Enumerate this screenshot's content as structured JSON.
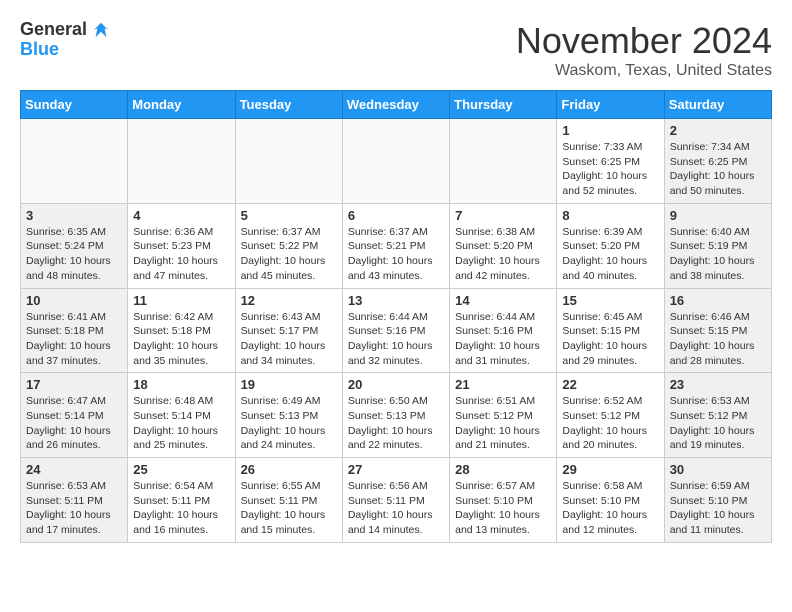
{
  "header": {
    "logo_general": "General",
    "logo_blue": "Blue",
    "month": "November 2024",
    "location": "Waskom, Texas, United States"
  },
  "weekdays": [
    "Sunday",
    "Monday",
    "Tuesday",
    "Wednesday",
    "Thursday",
    "Friday",
    "Saturday"
  ],
  "weeks": [
    [
      {
        "day": "",
        "info": ""
      },
      {
        "day": "",
        "info": ""
      },
      {
        "day": "",
        "info": ""
      },
      {
        "day": "",
        "info": ""
      },
      {
        "day": "",
        "info": ""
      },
      {
        "day": "1",
        "info": "Sunrise: 7:33 AM\nSunset: 6:25 PM\nDaylight: 10 hours\nand 52 minutes."
      },
      {
        "day": "2",
        "info": "Sunrise: 7:34 AM\nSunset: 6:25 PM\nDaylight: 10 hours\nand 50 minutes."
      }
    ],
    [
      {
        "day": "3",
        "info": "Sunrise: 6:35 AM\nSunset: 5:24 PM\nDaylight: 10 hours\nand 48 minutes."
      },
      {
        "day": "4",
        "info": "Sunrise: 6:36 AM\nSunset: 5:23 PM\nDaylight: 10 hours\nand 47 minutes."
      },
      {
        "day": "5",
        "info": "Sunrise: 6:37 AM\nSunset: 5:22 PM\nDaylight: 10 hours\nand 45 minutes."
      },
      {
        "day": "6",
        "info": "Sunrise: 6:37 AM\nSunset: 5:21 PM\nDaylight: 10 hours\nand 43 minutes."
      },
      {
        "day": "7",
        "info": "Sunrise: 6:38 AM\nSunset: 5:20 PM\nDaylight: 10 hours\nand 42 minutes."
      },
      {
        "day": "8",
        "info": "Sunrise: 6:39 AM\nSunset: 5:20 PM\nDaylight: 10 hours\nand 40 minutes."
      },
      {
        "day": "9",
        "info": "Sunrise: 6:40 AM\nSunset: 5:19 PM\nDaylight: 10 hours\nand 38 minutes."
      }
    ],
    [
      {
        "day": "10",
        "info": "Sunrise: 6:41 AM\nSunset: 5:18 PM\nDaylight: 10 hours\nand 37 minutes."
      },
      {
        "day": "11",
        "info": "Sunrise: 6:42 AM\nSunset: 5:18 PM\nDaylight: 10 hours\nand 35 minutes."
      },
      {
        "day": "12",
        "info": "Sunrise: 6:43 AM\nSunset: 5:17 PM\nDaylight: 10 hours\nand 34 minutes."
      },
      {
        "day": "13",
        "info": "Sunrise: 6:44 AM\nSunset: 5:16 PM\nDaylight: 10 hours\nand 32 minutes."
      },
      {
        "day": "14",
        "info": "Sunrise: 6:44 AM\nSunset: 5:16 PM\nDaylight: 10 hours\nand 31 minutes."
      },
      {
        "day": "15",
        "info": "Sunrise: 6:45 AM\nSunset: 5:15 PM\nDaylight: 10 hours\nand 29 minutes."
      },
      {
        "day": "16",
        "info": "Sunrise: 6:46 AM\nSunset: 5:15 PM\nDaylight: 10 hours\nand 28 minutes."
      }
    ],
    [
      {
        "day": "17",
        "info": "Sunrise: 6:47 AM\nSunset: 5:14 PM\nDaylight: 10 hours\nand 26 minutes."
      },
      {
        "day": "18",
        "info": "Sunrise: 6:48 AM\nSunset: 5:14 PM\nDaylight: 10 hours\nand 25 minutes."
      },
      {
        "day": "19",
        "info": "Sunrise: 6:49 AM\nSunset: 5:13 PM\nDaylight: 10 hours\nand 24 minutes."
      },
      {
        "day": "20",
        "info": "Sunrise: 6:50 AM\nSunset: 5:13 PM\nDaylight: 10 hours\nand 22 minutes."
      },
      {
        "day": "21",
        "info": "Sunrise: 6:51 AM\nSunset: 5:12 PM\nDaylight: 10 hours\nand 21 minutes."
      },
      {
        "day": "22",
        "info": "Sunrise: 6:52 AM\nSunset: 5:12 PM\nDaylight: 10 hours\nand 20 minutes."
      },
      {
        "day": "23",
        "info": "Sunrise: 6:53 AM\nSunset: 5:12 PM\nDaylight: 10 hours\nand 19 minutes."
      }
    ],
    [
      {
        "day": "24",
        "info": "Sunrise: 6:53 AM\nSunset: 5:11 PM\nDaylight: 10 hours\nand 17 minutes."
      },
      {
        "day": "25",
        "info": "Sunrise: 6:54 AM\nSunset: 5:11 PM\nDaylight: 10 hours\nand 16 minutes."
      },
      {
        "day": "26",
        "info": "Sunrise: 6:55 AM\nSunset: 5:11 PM\nDaylight: 10 hours\nand 15 minutes."
      },
      {
        "day": "27",
        "info": "Sunrise: 6:56 AM\nSunset: 5:11 PM\nDaylight: 10 hours\nand 14 minutes."
      },
      {
        "day": "28",
        "info": "Sunrise: 6:57 AM\nSunset: 5:10 PM\nDaylight: 10 hours\nand 13 minutes."
      },
      {
        "day": "29",
        "info": "Sunrise: 6:58 AM\nSunset: 5:10 PM\nDaylight: 10 hours\nand 12 minutes."
      },
      {
        "day": "30",
        "info": "Sunrise: 6:59 AM\nSunset: 5:10 PM\nDaylight: 10 hours\nand 11 minutes."
      }
    ]
  ]
}
